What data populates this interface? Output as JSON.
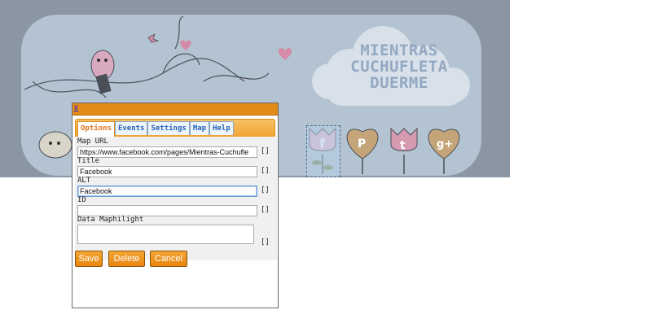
{
  "banner": {
    "title_lines": [
      "MIENTRAS",
      "CUCHUFLETA",
      "DUERME"
    ]
  },
  "dialog": {
    "close_label": "x",
    "tabs": [
      {
        "label": "Options",
        "active": true
      },
      {
        "label": "Events",
        "active": false
      },
      {
        "label": "Settings",
        "active": false
      },
      {
        "label": "Map",
        "active": false
      },
      {
        "label": "Help",
        "active": false
      }
    ],
    "fields": {
      "map_url": {
        "label": "Map URL",
        "value": "https://www.facebook.com/pages/Mientras-Cuchufle"
      },
      "title": {
        "label": "Title",
        "value": "Facebook"
      },
      "alt": {
        "label": "ALT",
        "value": "Facebook"
      },
      "id": {
        "label": "ID",
        "value": ""
      },
      "data_maphilight": {
        "label": "Data Maphilight",
        "value": ""
      }
    },
    "bracket_glyph": "[]",
    "buttons": {
      "save": "Save",
      "delete": "Delete",
      "cancel": "Cancel"
    }
  },
  "colors": {
    "accent": "#e28c17",
    "tab_text": "#2a63b5",
    "active_tab_text": "#e0731a"
  }
}
